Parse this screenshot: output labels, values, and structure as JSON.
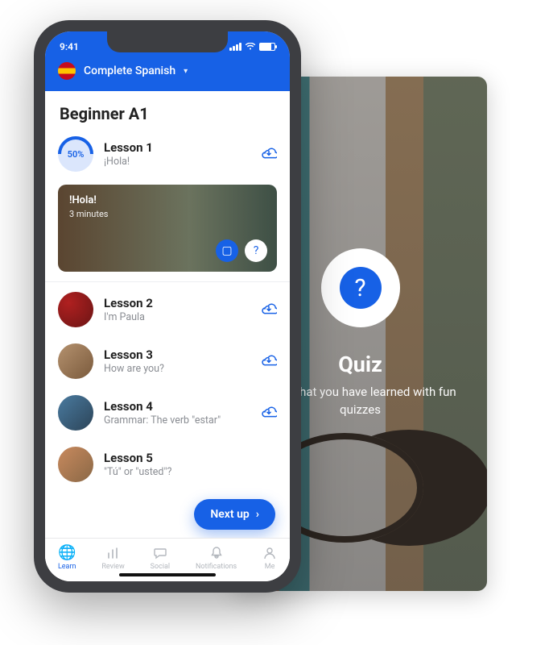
{
  "status": {
    "time": "9:41"
  },
  "course": {
    "name": "Complete Spanish"
  },
  "level": "Beginner A1",
  "lessons": [
    {
      "title": "Lesson 1",
      "subtitle": "¡Hola!",
      "progress": "50%"
    },
    {
      "title": "Lesson 2",
      "subtitle": "I'm Paula"
    },
    {
      "title": "Lesson 3",
      "subtitle": "How are you?"
    },
    {
      "title": "Lesson 4",
      "subtitle": "Grammar: The verb \"estar\""
    },
    {
      "title": "Lesson 5",
      "subtitle": "\"Tú\" or \"usted\"?"
    }
  ],
  "expanded": {
    "title": "!Hola!",
    "duration": "3 minutes"
  },
  "next_label": "Next up",
  "tabs": [
    {
      "label": "Learn"
    },
    {
      "label": "Review"
    },
    {
      "label": "Social"
    },
    {
      "label": "Notifications"
    },
    {
      "label": "Me"
    }
  ],
  "promo": {
    "icon_char": "?",
    "title": "Quiz",
    "subtitle": "Test what you have learned with fun quizzes"
  }
}
